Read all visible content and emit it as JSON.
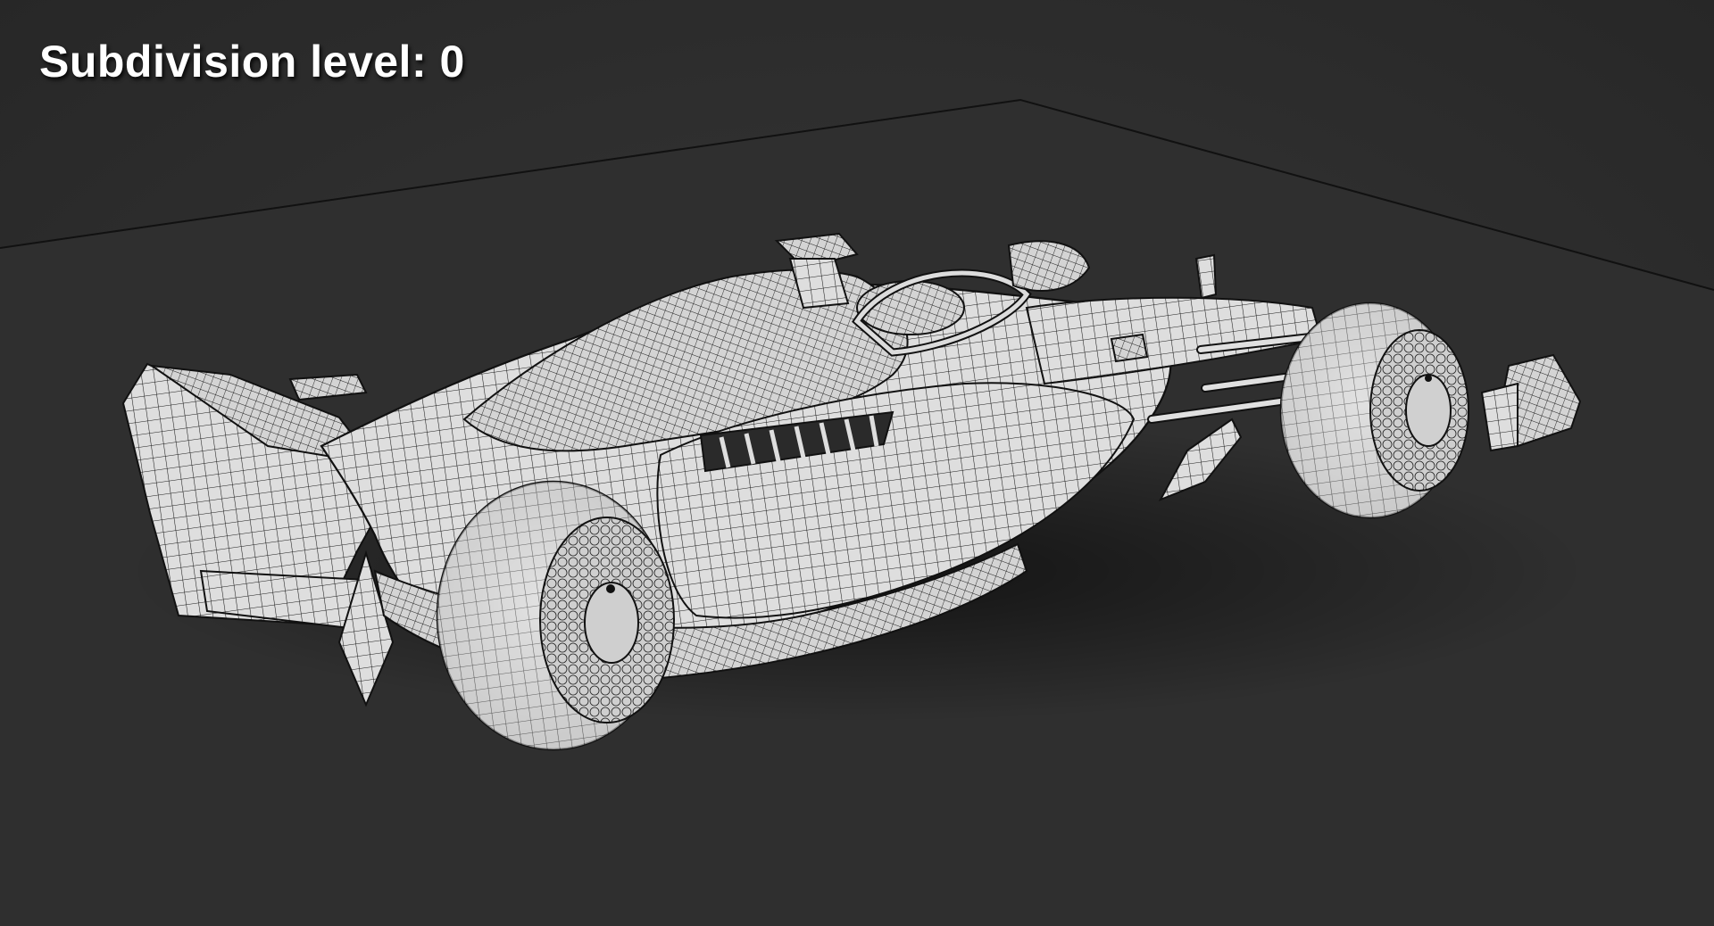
{
  "viewport": {
    "label": "Subdivision level: 0"
  },
  "colors": {
    "background": "#2e2e2e",
    "model_fill": "#d9d9d9",
    "wire": "#1e1e1e",
    "label_text": "#ffffff"
  },
  "scene": {
    "subject": "wireframe-f1-car",
    "ground": "ground-plane"
  }
}
